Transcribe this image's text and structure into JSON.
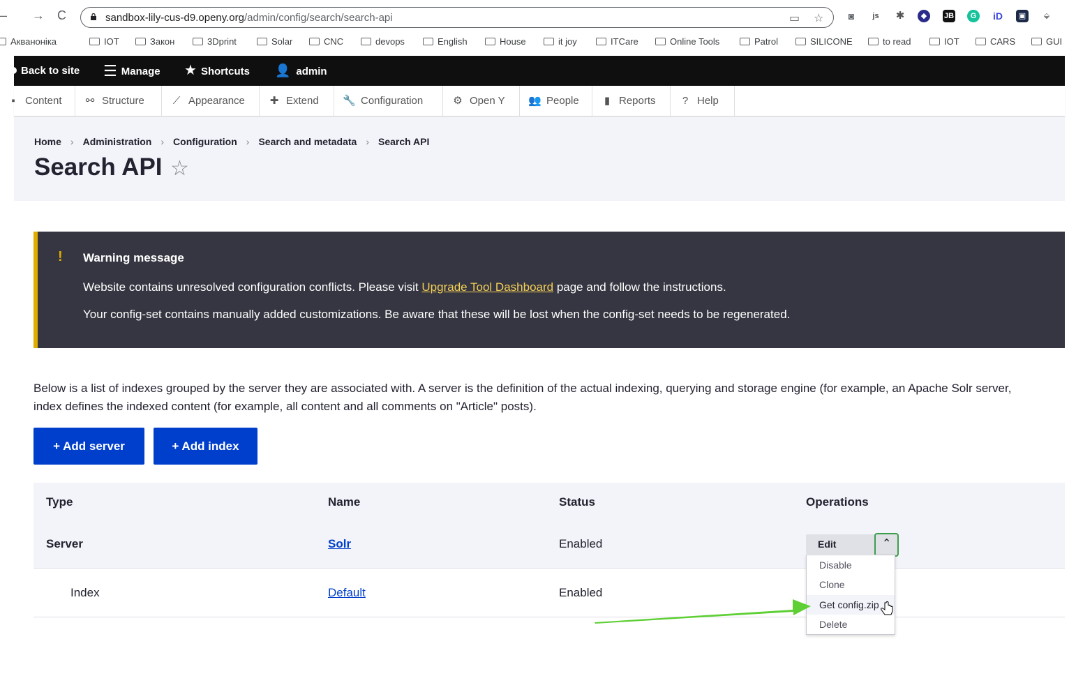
{
  "browser": {
    "url_host": "sandbox-lily-cus-d9.openy.org",
    "url_path": "/admin/config/search/search-api",
    "bookmarks": [
      "Акваноніка",
      "IOT",
      "Закон",
      "3Dprint",
      "Solar",
      "CNC",
      "devops",
      "English",
      "House",
      "it joy",
      "ITCare",
      "Online Tools",
      "Patrol",
      "SILICONE",
      "to read",
      "IOT",
      "CARS",
      "GUI"
    ]
  },
  "toolbar": {
    "back": "Back to site",
    "manage": "Manage",
    "shortcuts": "Shortcuts",
    "user": "admin"
  },
  "admin_menu": {
    "items": [
      "Content",
      "Structure",
      "Appearance",
      "Extend",
      "Configuration",
      "Open Y",
      "People",
      "Reports",
      "Help"
    ]
  },
  "breadcrumb": [
    "Home",
    "Administration",
    "Configuration",
    "Search and metadata",
    "Search API"
  ],
  "page": {
    "title": "Search API"
  },
  "warning": {
    "title": "Warning message",
    "line1_before": "Website contains unresolved configuration conflicts. Please visit ",
    "line1_link": "Upgrade Tool Dashboard",
    "line1_after": " page and follow the instructions.",
    "line2": "Your config-set contains manually added customizations. Be aware that these will be lost when the config-set needs to be regenerated."
  },
  "description": {
    "line1": "Below is a list of indexes grouped by the server they are associated with. A server is the definition of the actual indexing, querying and storage engine (for example, an Apache Solr server,",
    "line2": "index defines the indexed content (for example, all content and all comments on \"Article\" posts)."
  },
  "actions": {
    "add_server": "+ Add server",
    "add_index": "+ Add index"
  },
  "table": {
    "headers": [
      "Type",
      "Name",
      "Status",
      "Operations"
    ],
    "rows": [
      {
        "type": "Server",
        "name": "Solr",
        "status": "Enabled"
      },
      {
        "type": "Index",
        "name": "Default",
        "status": "Enabled"
      }
    ]
  },
  "operations": {
    "primary": "Edit",
    "menu": [
      "Disable",
      "Clone",
      "Get config.zip",
      "Delete"
    ]
  },
  "colors": {
    "primary_button": "#003ecc",
    "warning_bg": "#353641",
    "warning_accent": "#e0ac00",
    "annotation_arrow": "#5ecf35"
  }
}
